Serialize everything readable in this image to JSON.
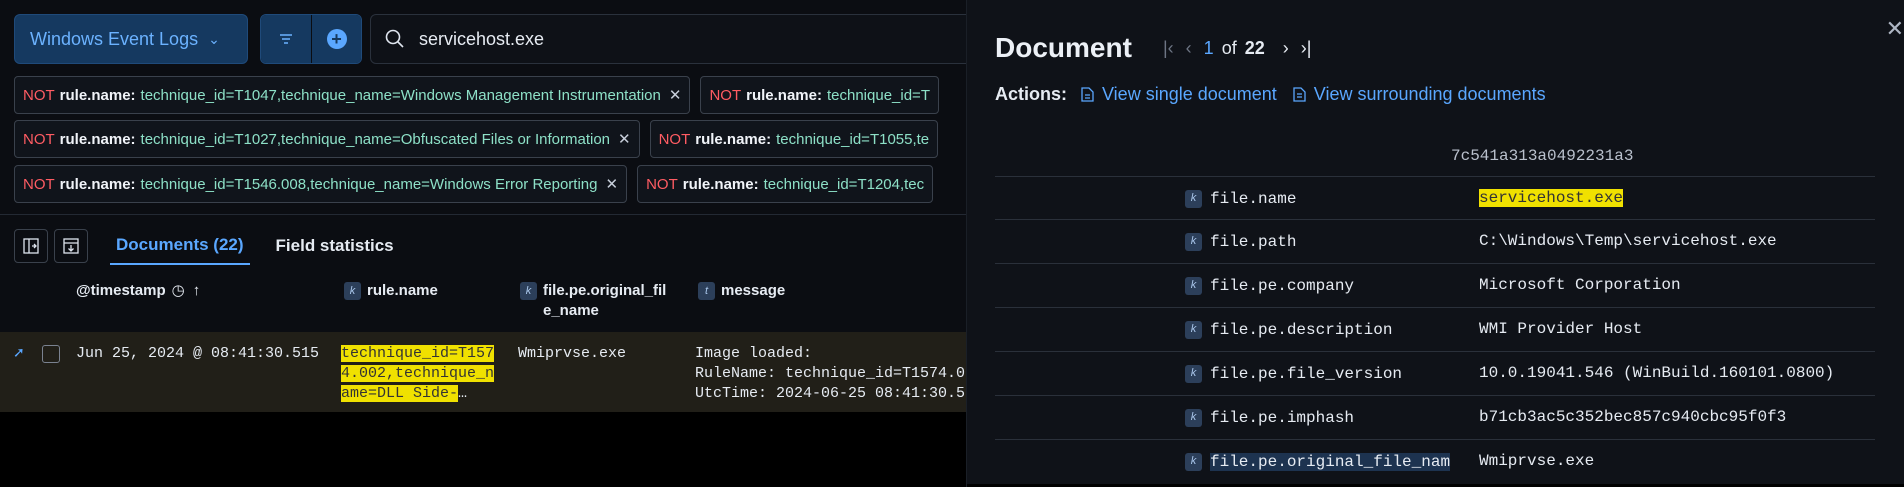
{
  "left": {
    "data_view": "Windows Event Logs",
    "search_query": "servicehost.exe",
    "filters": [
      [
        {
          "not": "NOT",
          "field": "rule.name:",
          "value": "technique_id=T1047,technique_name=Windows Management Instrumentation"
        },
        {
          "not": "NOT",
          "field": "rule.name:",
          "value": "technique_id=T"
        }
      ],
      [
        {
          "not": "NOT",
          "field": "rule.name:",
          "value": "technique_id=T1027,technique_name=Obfuscated Files or Information"
        },
        {
          "not": "NOT",
          "field": "rule.name:",
          "value": "technique_id=T1055,te"
        }
      ],
      [
        {
          "not": "NOT",
          "field": "rule.name:",
          "value": "technique_id=T1546.008,technique_name=Windows Error Reporting"
        },
        {
          "not": "NOT",
          "field": "rule.name:",
          "value": "technique_id=T1204,tec"
        }
      ]
    ],
    "tabs": {
      "documents": "Documents (22)",
      "field_stats": "Field statistics"
    },
    "columns": {
      "timestamp": "@timestamp",
      "rule_name": "rule.name",
      "original_file": "file.pe.original_fil e_name",
      "message": "message",
      "badge_k": "k",
      "badge_t": "t"
    },
    "row": {
      "timestamp": "Jun 25, 2024 @ 08:41:30.515",
      "rule_line1": "technique_id=T157",
      "rule_line2": "4.002,technique_n",
      "rule_line3a": "ame=DLL Side-",
      "rule_line3b": "…",
      "original_file": "Wmiprvse.exe",
      "msg_line1": "Image loaded:",
      "msg_line2": "RuleName: technique_id=T1574.0",
      "msg_line3": "UtcTime: 2024-06-25 08:41:30.5"
    }
  },
  "right": {
    "title": "Document",
    "pager": {
      "current": "1",
      "of": "of",
      "total": "22"
    },
    "actions_label": "Actions:",
    "view_single": "View single document",
    "view_surrounding": "View surrounding documents",
    "top_hash": "7c541a313a0492231a3",
    "fields": [
      {
        "name": "file.name",
        "value": "servicehost.exe"
      },
      {
        "name": "file.path",
        "value": "C:\\Windows\\Temp\\servicehost.exe"
      },
      {
        "name": "file.pe.company",
        "value": "Microsoft Corporation"
      },
      {
        "name": "file.pe.description",
        "value": "WMI Provider Host"
      },
      {
        "name": "file.pe.file_version",
        "value": "10.0.19041.546 (WinBuild.160101.0800)"
      },
      {
        "name": "file.pe.imphash",
        "value": "b71cb3ac5c352bec857c940cbc95f0f3"
      },
      {
        "name": "file.pe.original_file_nam",
        "value": "Wmiprvse.exe"
      }
    ]
  },
  "colors": {
    "accent": "#5aa7ff",
    "highlight": "#f0e100",
    "negation": "#ff5c63"
  }
}
